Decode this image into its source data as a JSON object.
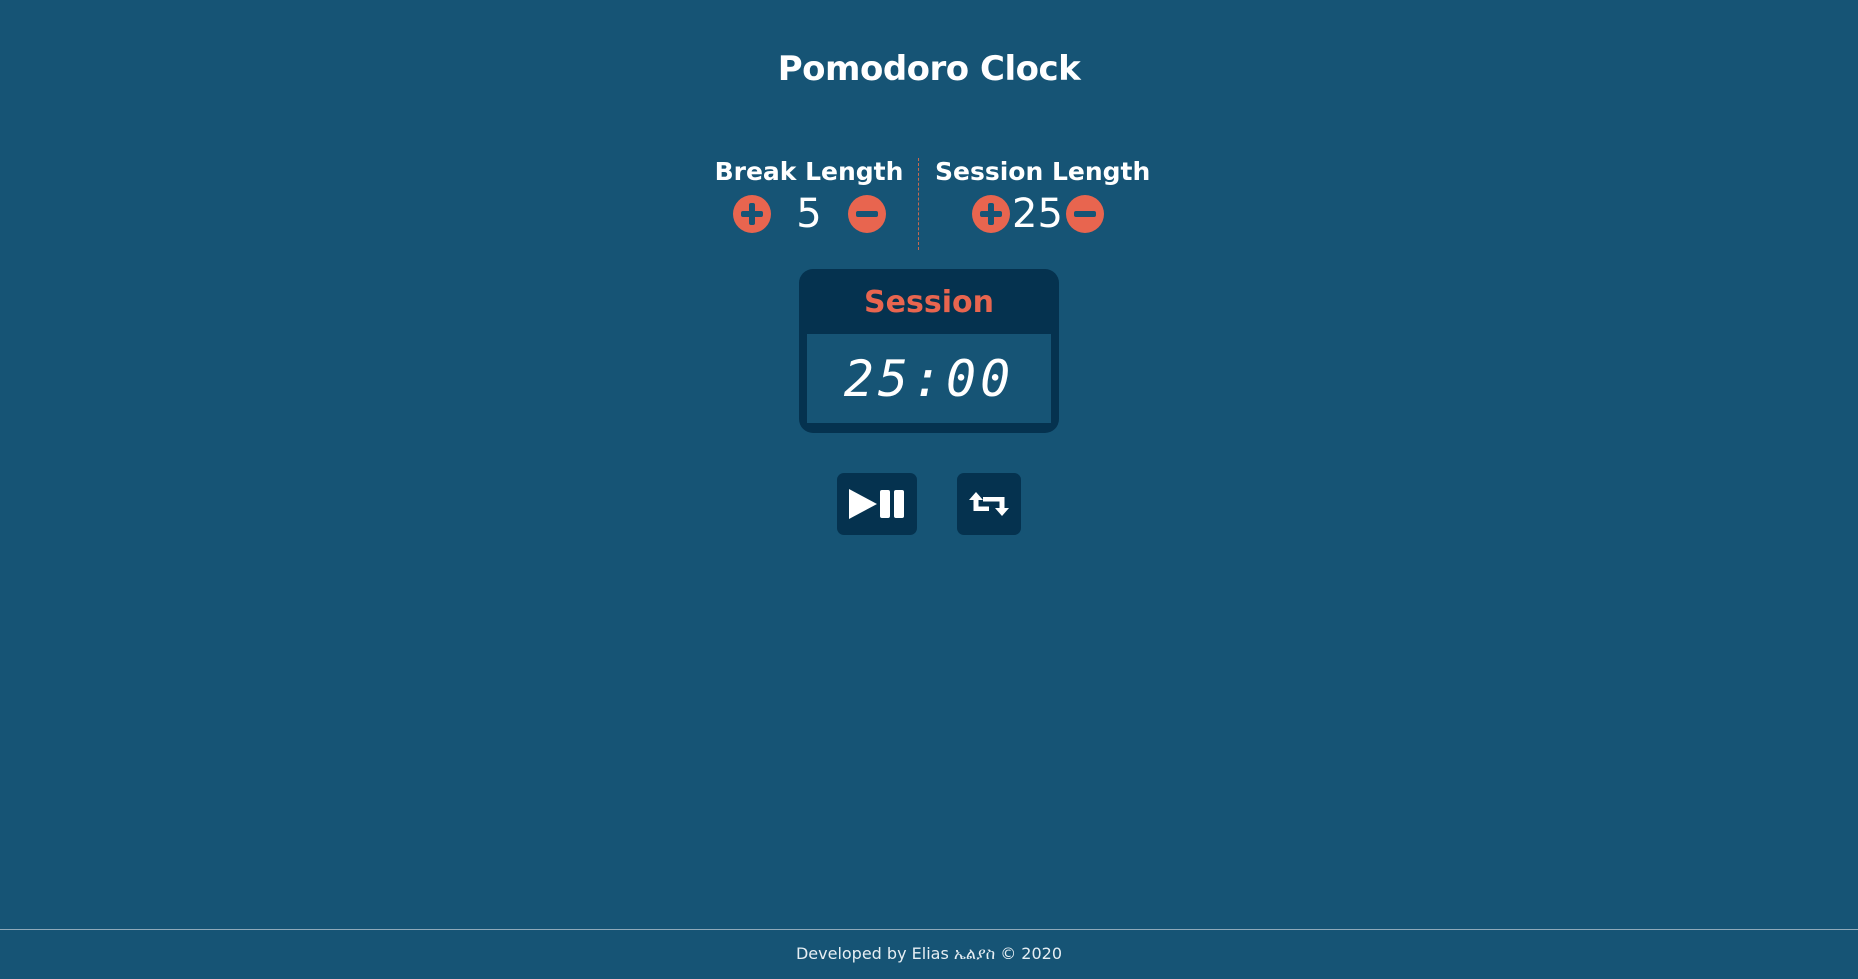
{
  "title": "Pomodoro Clock",
  "break": {
    "label": "Break Length",
    "value": "5",
    "increment_icon": "plus-circle-icon",
    "decrement_icon": "minus-circle-icon"
  },
  "session": {
    "label": "Session Length",
    "value": "25",
    "increment_icon": "plus-circle-icon",
    "decrement_icon": "minus-circle-icon"
  },
  "timer": {
    "label": "Session",
    "display": "25:00"
  },
  "controls": {
    "play_pause_icon": "play-pause-icon",
    "reset_icon": "retweet-reset-icon"
  },
  "footer": {
    "text": "Developed by Elias ኤልያስ © 2020"
  },
  "colors": {
    "background": "#165475",
    "panel": "#05324f",
    "accent": "#e8654f",
    "text": "#ffffff"
  }
}
